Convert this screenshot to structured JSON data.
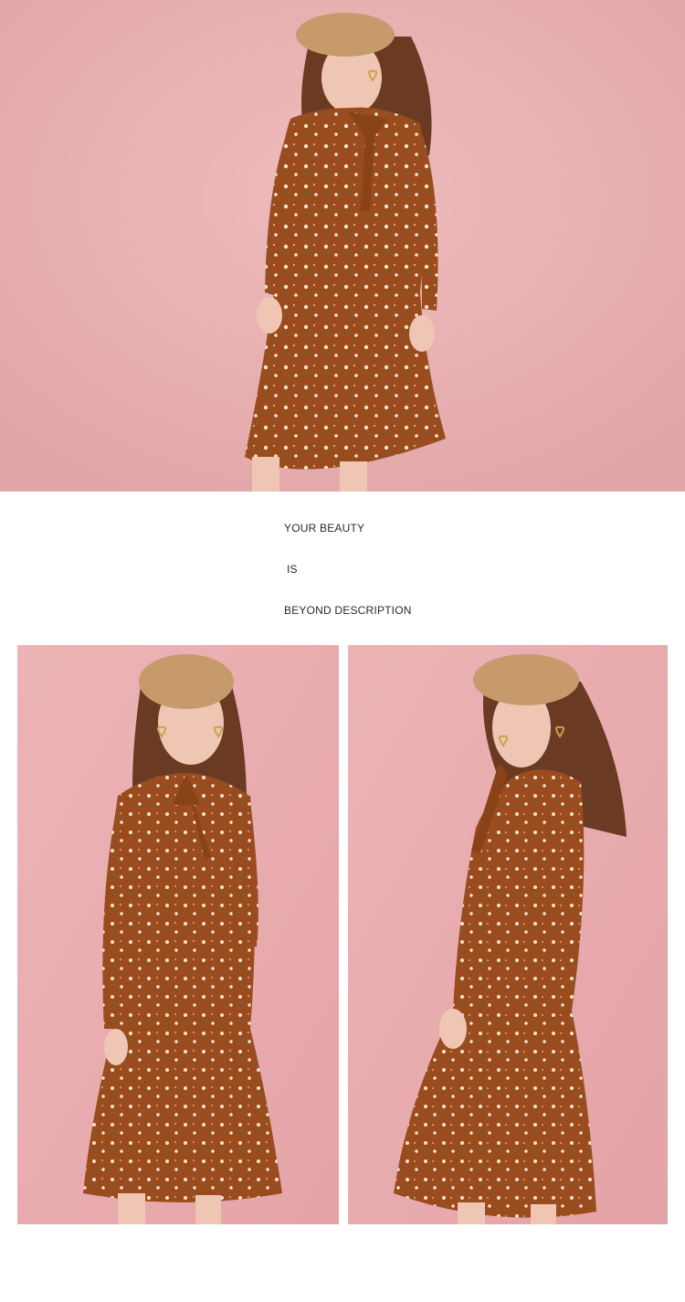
{
  "colors": {
    "backdrop_pink": "#e8aeb0",
    "dress_rust": "#9a4c1f",
    "beret_tan": "#c79a6b",
    "hair_brown": "#6b3a22",
    "skin": "#efc6b4",
    "text": "#2a2a2a",
    "page_bg": "#ffffff"
  },
  "captions": {
    "line1": "YOUR BEAUTY",
    "line2": "IS",
    "line3": "BEYOND DESCRIPTION"
  },
  "photos": {
    "hero": "model-photo-front-cropped",
    "left": "model-photo-front-full",
    "right": "model-photo-side"
  }
}
